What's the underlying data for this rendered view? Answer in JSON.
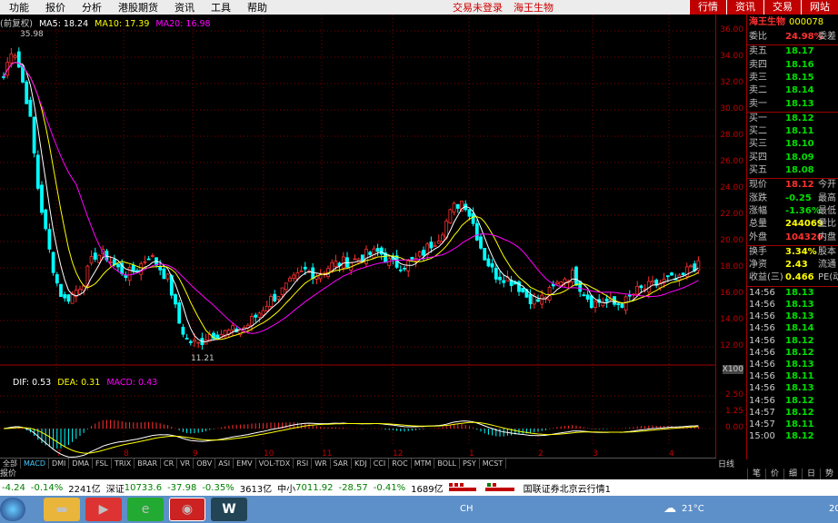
{
  "menu": {
    "items": [
      "功能",
      "报价",
      "分析",
      "港股期货",
      "资讯",
      "工具",
      "帮助"
    ],
    "trade_status": "交易未登录",
    "stock_name": "海王生物",
    "right_tabs": [
      "行情",
      "资讯",
      "交易",
      "网站"
    ]
  },
  "legend": {
    "prefix": "(前复权)",
    "ma5": "MA5: 18.24",
    "ma10": "MA10: 17.39",
    "ma20": "MA20: 16.98"
  },
  "price_max_label": "35.98",
  "price_min_label": "11.21",
  "macd_legend": {
    "dif": "DIF: 0.53",
    "dea": "DEA: 0.31",
    "macd": "MACD: 0.43"
  },
  "y_axis_ticks": [
    "36.00",
    "34.00",
    "32.00",
    "30.00",
    "28.00",
    "26.00",
    "24.00",
    "22.00",
    "20.00",
    "18.00",
    "16.00",
    "14.00",
    "12.00"
  ],
  "macd_axis_ticks": [
    "2.50",
    "1.25",
    "0.00"
  ],
  "macd_axis_unit": "X100",
  "x_axis_months": [
    "7",
    "8",
    "9",
    "10",
    "11",
    "12",
    "1",
    "2",
    "3",
    "4"
  ],
  "indicator_tabs": [
    "全部",
    "MACD",
    "DMI",
    "DMA",
    "FSL",
    "TRIX",
    "BRAR",
    "CR",
    "VR",
    "OBV",
    "ASI",
    "EMV",
    "VOL-TDX",
    "RSI",
    "WR",
    "SAR",
    "KDJ",
    "CCI",
    "ROC",
    "MTM",
    "BOLL",
    "PSY",
    "MCST"
  ],
  "report_label": "报价",
  "period_label": "日线",
  "mini_controls": "+ -",
  "quote_panel": {
    "title": "海王生物",
    "code": "000078",
    "weibi": {
      "label": "委比",
      "value": "24.98%",
      "ext": "委差"
    },
    "asks": [
      {
        "label": "卖五",
        "price": "18.17"
      },
      {
        "label": "卖四",
        "price": "18.16"
      },
      {
        "label": "卖三",
        "price": "18.15"
      },
      {
        "label": "卖二",
        "price": "18.14"
      },
      {
        "label": "卖一",
        "price": "18.13"
      }
    ],
    "bids": [
      {
        "label": "买一",
        "price": "18.12"
      },
      {
        "label": "买二",
        "price": "18.11"
      },
      {
        "label": "买三",
        "price": "18.10"
      },
      {
        "label": "买四",
        "price": "18.09"
      },
      {
        "label": "买五",
        "price": "18.08"
      }
    ],
    "stats": [
      {
        "label": "现价",
        "value": "18.12",
        "ext": "今开",
        "color": "#ff3030"
      },
      {
        "label": "涨跌",
        "value": "-0.25",
        "ext": "最高",
        "color": "#00e000"
      },
      {
        "label": "涨幅",
        "value": "-1.36%",
        "ext": "最低",
        "color": "#00e000"
      },
      {
        "label": "总量",
        "value": "244069",
        "ext": "量比",
        "color": "#ffff00"
      },
      {
        "label": "外盘",
        "value": "104326",
        "ext": "内盘",
        "color": "#ff3030"
      }
    ],
    "stats2": [
      {
        "label": "换手",
        "value": "3.34%",
        "ext": "股本",
        "color": "#ffff00"
      },
      {
        "label": "净资",
        "value": "2.43",
        "ext": "流通",
        "color": "#ffff00"
      },
      {
        "label": "收益(三)",
        "value": "0.466",
        "ext": "PE(动)",
        "color": "#ffff00"
      }
    ],
    "ticks": [
      {
        "time": "14:56",
        "price": "18.13"
      },
      {
        "time": "14:56",
        "price": "18.13"
      },
      {
        "time": "14:56",
        "price": "18.13"
      },
      {
        "time": "14:56",
        "price": "18.14"
      },
      {
        "time": "14:56",
        "price": "18.12"
      },
      {
        "time": "14:56",
        "price": "18.12"
      },
      {
        "time": "14:56",
        "price": "18.13"
      },
      {
        "time": "14:56",
        "price": "18.11"
      },
      {
        "time": "14:56",
        "price": "18.13"
      },
      {
        "time": "14:56",
        "price": "18.12"
      },
      {
        "time": "14:57",
        "price": "18.12"
      },
      {
        "time": "14:57",
        "price": "18.11"
      },
      {
        "time": "15:00",
        "price": "18.12"
      }
    ],
    "bottom_tabs": [
      "笔",
      "价",
      "细",
      "日",
      "势"
    ]
  },
  "status_bar": {
    "sh_change": "-4.24",
    "sh_pct": "-0.14%",
    "sh_amount": "2241亿",
    "sz_label": "深证",
    "sz_index": "10733.6",
    "sz_change": "-37.98",
    "sz_pct": "-0.35%",
    "sz_amount": "3613亿",
    "zx_label": "中小",
    "zx_index": "7011.92",
    "zx_change": "-28.57",
    "zx_pct": "-0.41%",
    "zx_amount": "1689亿",
    "broker": "国联证券北京云行情1"
  },
  "taskbar": {
    "lang": "CH",
    "temp": "21°C",
    "time": "20"
  },
  "colors": {
    "up": "#ff3030",
    "down": "#00ffff",
    "ma5": "#ffffff",
    "ma10": "#ffff00",
    "ma20": "#ff00ff",
    "grid": "#800000"
  }
}
